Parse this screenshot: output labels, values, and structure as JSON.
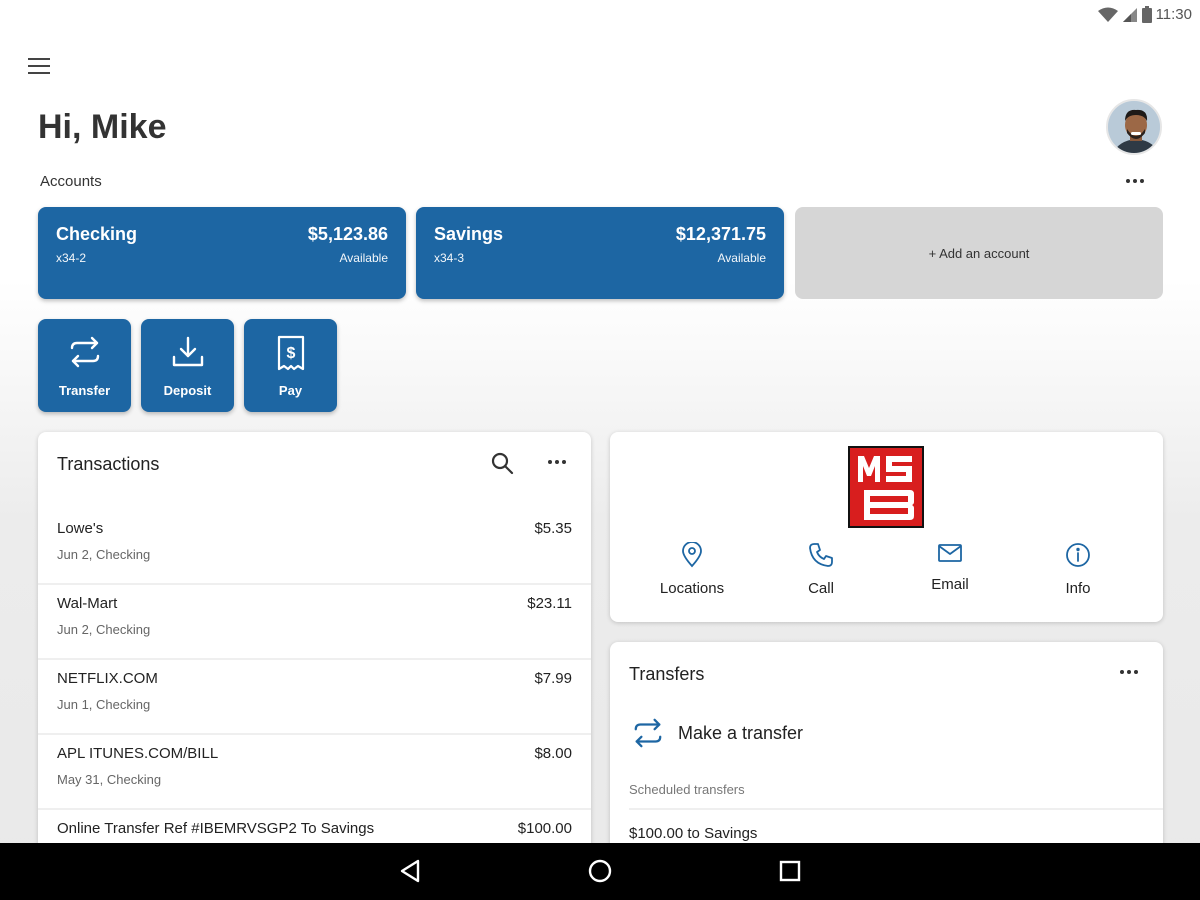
{
  "status_bar": {
    "time": "11:30",
    "icons": [
      "wifi-icon",
      "cell-signal-icon",
      "battery-icon"
    ]
  },
  "header": {
    "menu_icon": "hamburger-menu-icon",
    "greeting": "Hi, Mike",
    "avatar_icon": "user-avatar"
  },
  "accounts": {
    "label": "Accounts",
    "more_icon": "more-horizontal-icon",
    "cards": [
      {
        "name": "Checking",
        "number": "x34-2",
        "balance": "$5,123.86",
        "balance_label": "Available"
      },
      {
        "name": "Savings",
        "number": "x34-3",
        "balance": "$12,371.75",
        "balance_label": "Available"
      }
    ],
    "add_account_label": "+ Add an account"
  },
  "actions": [
    {
      "label": "Transfer",
      "icon": "transfer-arrows-icon"
    },
    {
      "label": "Deposit",
      "icon": "deposit-download-icon"
    },
    {
      "label": "Pay",
      "icon": "bill-receipt-icon"
    }
  ],
  "transactions": {
    "title": "Transactions",
    "search_icon": "search-icon",
    "more_icon": "more-horizontal-icon",
    "items": [
      {
        "merchant": "Lowe's",
        "detail": "Jun 2, Checking",
        "amount": "$5.35"
      },
      {
        "merchant": "Wal-Mart",
        "detail": "Jun 2, Checking",
        "amount": "$23.11"
      },
      {
        "merchant": "NETFLIX.COM",
        "detail": "Jun 1, Checking",
        "amount": "$7.99"
      },
      {
        "merchant": "APL ITUNES.COM/BILL",
        "detail": "May 31, Checking",
        "amount": "$8.00"
      },
      {
        "merchant": "Online Transfer Ref #IBEMRVSGP2 To Savings",
        "detail": "",
        "amount": "$100.00"
      }
    ]
  },
  "bank": {
    "logo_icon": "bank-logo",
    "logo_text": "MSB",
    "links": [
      {
        "label": "Locations",
        "icon": "location-pin-icon"
      },
      {
        "label": "Call",
        "icon": "phone-icon"
      },
      {
        "label": "Email",
        "icon": "email-icon"
      },
      {
        "label": "Info",
        "icon": "info-icon"
      }
    ]
  },
  "transfers": {
    "title": "Transfers",
    "more_icon": "more-horizontal-icon",
    "make_transfer_label": "Make a transfer",
    "make_transfer_icon": "transfer-arrows-icon",
    "scheduled_label": "Scheduled transfers",
    "scheduled_items": [
      "$100.00 to Savings"
    ]
  },
  "nav_bar": {
    "icons": [
      "back-triangle-icon",
      "home-circle-icon",
      "recents-square-icon"
    ]
  },
  "colors": {
    "accent": "#1d66a3",
    "logo_red": "#d81e1e",
    "add_card_gray": "#d6d6d6"
  }
}
